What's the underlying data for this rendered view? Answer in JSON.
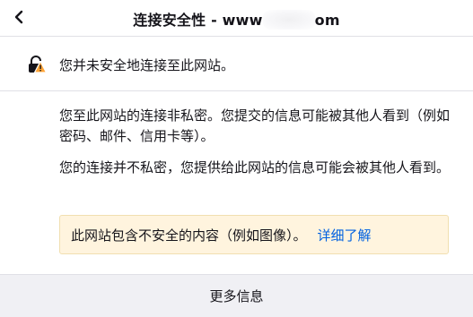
{
  "header": {
    "back_icon": "chevron-left-icon",
    "title_prefix": "连接安全性 - www",
    "title_suffix": "om"
  },
  "status": {
    "icon": "insecure-lock-warning-icon",
    "text": "您并未安全地连接至此网站。"
  },
  "body": {
    "paragraph1": "您至此网站的连接非私密。您提交的信息可能被其他人看到（例如密码、邮件、信用卡等）。",
    "paragraph2": "您的连接并不私密，您提供给此网站的信息可能会被其他人看到。"
  },
  "notice": {
    "text": "此网站包含不安全的内容（例如图像）。",
    "link": "详细了解",
    "background": "#fff4de",
    "link_color": "#0061e0"
  },
  "footer": {
    "more_info_label": "更多信息"
  }
}
